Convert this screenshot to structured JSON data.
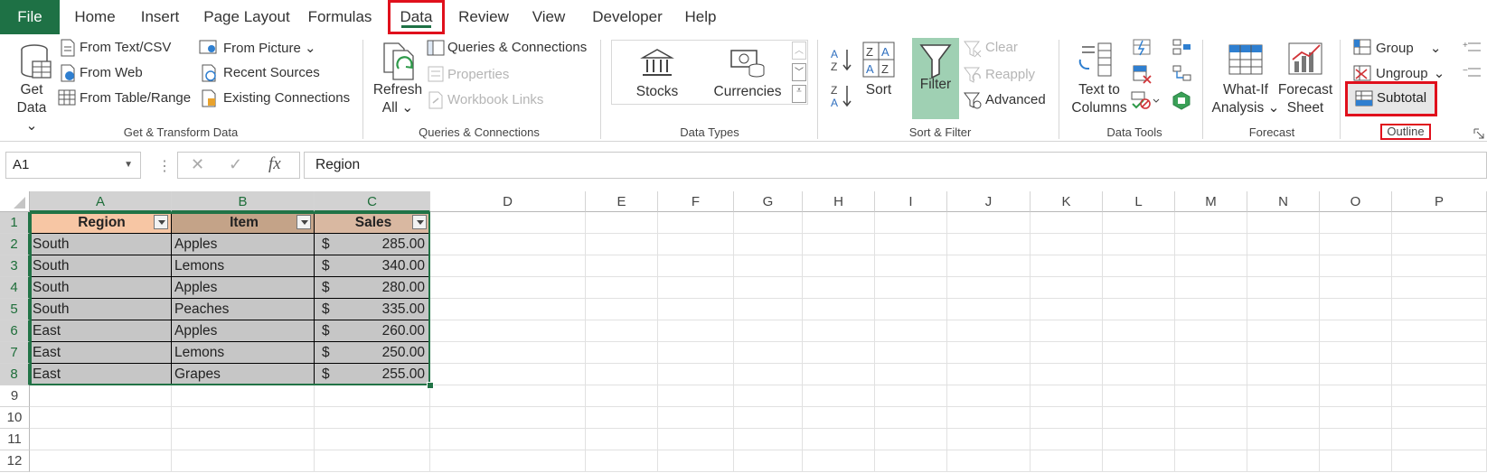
{
  "tabs": {
    "file": "File",
    "home": "Home",
    "insert": "Insert",
    "page_layout": "Page Layout",
    "formulas": "Formulas",
    "data": "Data",
    "review": "Review",
    "view": "View",
    "developer": "Developer",
    "help": "Help"
  },
  "get_transform": {
    "get_data_1": "Get",
    "get_data_2": "Data",
    "from_text_csv": "From Text/CSV",
    "from_web": "From Web",
    "from_table_range": "From Table/Range",
    "from_picture": "From Picture",
    "recent_sources": "Recent Sources",
    "existing_connections": "Existing Connections",
    "group_label": "Get & Transform Data"
  },
  "queries": {
    "refresh_1": "Refresh",
    "refresh_2": "All",
    "queries_connections": "Queries & Connections",
    "properties": "Properties",
    "workbook_links": "Workbook Links",
    "group_label": "Queries & Connections"
  },
  "data_types": {
    "stocks": "Stocks",
    "currencies": "Currencies",
    "group_label": "Data Types"
  },
  "sort_filter": {
    "sort": "Sort",
    "filter": "Filter",
    "clear": "Clear",
    "reapply": "Reapply",
    "advanced": "Advanced",
    "group_label": "Sort & Filter"
  },
  "data_tools": {
    "text_to_columns_1": "Text to",
    "text_to_columns_2": "Columns",
    "group_label": "Data Tools"
  },
  "forecast": {
    "what_if_1": "What-If",
    "what_if_2": "Analysis",
    "forecast_sheet_1": "Forecast",
    "forecast_sheet_2": "Sheet",
    "group_label": "Forecast"
  },
  "outline": {
    "group": "Group",
    "ungroup": "Ungroup",
    "subtotal": "Subtotal",
    "group_label": "Outline"
  },
  "formula_bar": {
    "name_box": "A1",
    "fx": "fx",
    "content": "Region"
  },
  "columns": [
    "A",
    "B",
    "C",
    "D",
    "E",
    "F",
    "G",
    "H",
    "I",
    "J",
    "K",
    "L",
    "M",
    "N",
    "O",
    "P"
  ],
  "rows": [
    "1",
    "2",
    "3",
    "4",
    "5",
    "6",
    "7",
    "8",
    "9",
    "10",
    "11",
    "12"
  ],
  "table": {
    "headers": [
      "Region",
      "Item",
      "Sales"
    ],
    "currency_symbol": "$",
    "rows": [
      [
        "South",
        "Apples",
        "285.00"
      ],
      [
        "South",
        "Lemons",
        "340.00"
      ],
      [
        "South",
        "Apples",
        "280.00"
      ],
      [
        "South",
        "Peaches",
        "335.00"
      ],
      [
        "East",
        "Apples",
        "260.00"
      ],
      [
        "East",
        "Lemons",
        "250.00"
      ],
      [
        "East",
        "Grapes",
        "255.00"
      ]
    ]
  },
  "colors": {
    "excel_green": "#1e7145",
    "highlight_red": "#e0101c",
    "filter_active": "#9fd0b3"
  }
}
